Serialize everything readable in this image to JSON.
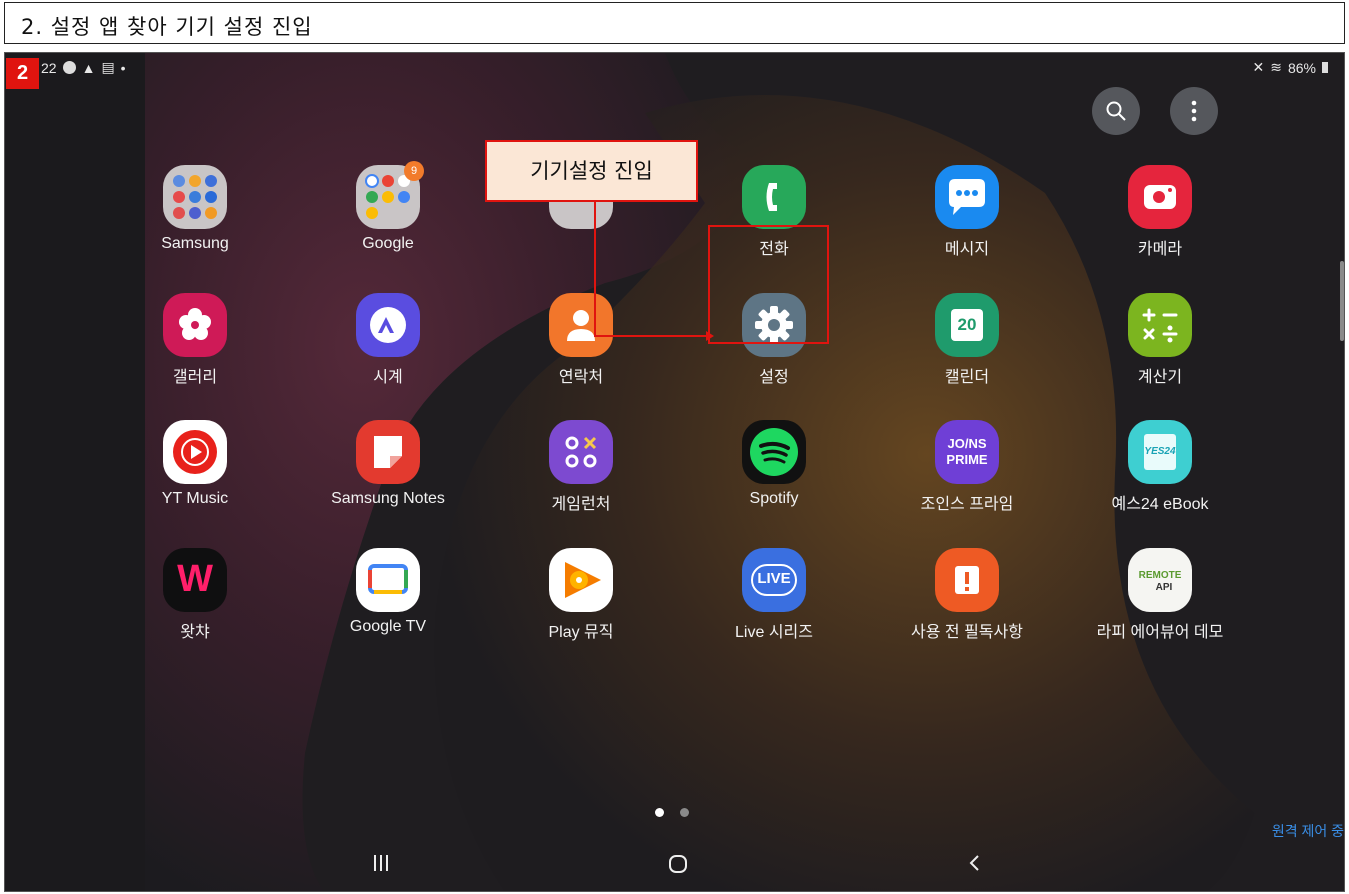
{
  "header": {
    "title": "2. 설정 앱 찾아 기기 설정 진입"
  },
  "step_badge": "2",
  "status_bar": {
    "time": "22",
    "battery": "86%"
  },
  "callout": {
    "text": "기기설정 진입"
  },
  "apps": [
    {
      "label": "Samsung"
    },
    {
      "label": "Google"
    },
    {
      "label": ""
    },
    {
      "label": "전화"
    },
    {
      "label": "메시지"
    },
    {
      "label": "카메라"
    },
    {
      "label": "갤러리"
    },
    {
      "label": "시계"
    },
    {
      "label": "연락처"
    },
    {
      "label": "설정"
    },
    {
      "label": "캘린더"
    },
    {
      "label": "계산기"
    },
    {
      "label": "YT Music"
    },
    {
      "label": "Samsung Notes"
    },
    {
      "label": "게임런처"
    },
    {
      "label": "Spotify"
    },
    {
      "label": "조인스 프라임"
    },
    {
      "label": "예스24 eBook"
    },
    {
      "label": "왓챠"
    },
    {
      "label": "Google TV"
    },
    {
      "label": "Play 뮤직"
    },
    {
      "label": "Live 시리즈"
    },
    {
      "label": "사용 전 필독사항"
    },
    {
      "label": "라피 에어뷰어 데모"
    }
  ],
  "google_badge": "9",
  "calendar_day": "20",
  "icon_text": {
    "joins": "JO/NS",
    "joins2": "PRIME",
    "yes24": "YES24",
    "watcha": "W",
    "live": "LIVE",
    "remote": "REMOTE",
    "api": "API"
  },
  "remote_status": "원격 제어 중",
  "nav": {
    "recents": "|||",
    "home": "O",
    "back": "<"
  }
}
